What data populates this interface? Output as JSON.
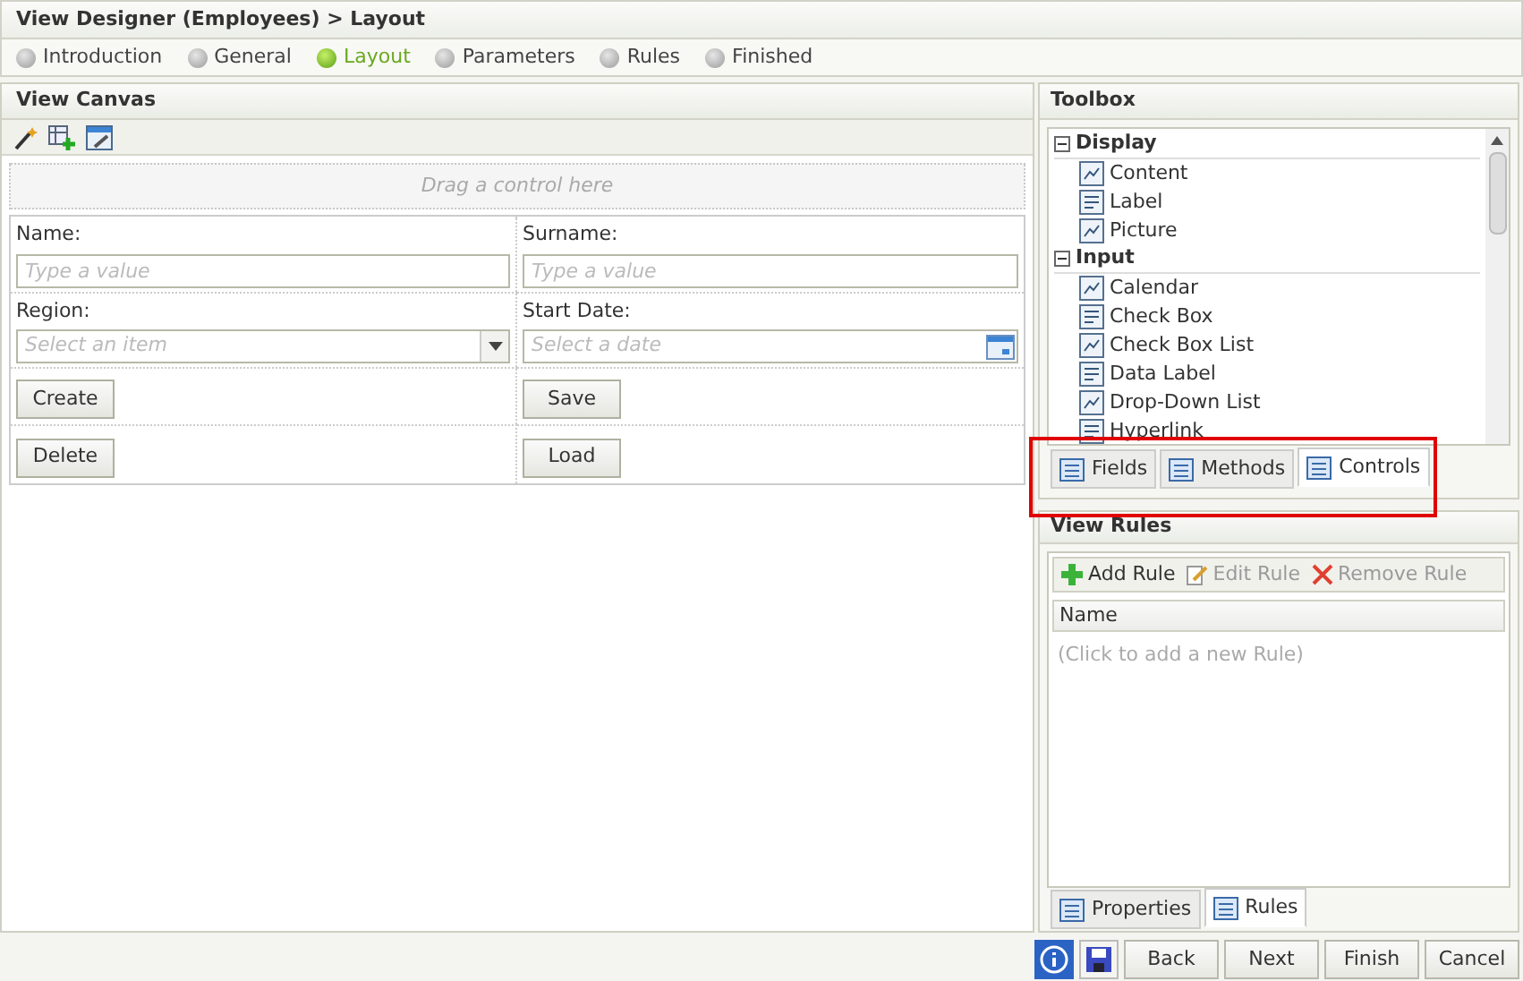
{
  "window": {
    "title": "View Designer (Employees) > Layout"
  },
  "steps": [
    {
      "label": "Introduction",
      "selected": false
    },
    {
      "label": "General",
      "selected": false
    },
    {
      "label": "Layout",
      "selected": true
    },
    {
      "label": "Parameters",
      "selected": false
    },
    {
      "label": "Rules",
      "selected": false
    },
    {
      "label": "Finished",
      "selected": false
    }
  ],
  "canvas": {
    "title": "View Canvas",
    "drop_hint": "Drag a control here",
    "rows": [
      [
        {
          "kind": "field",
          "label": "Name:",
          "placeholder": "Type a value"
        },
        {
          "kind": "field",
          "label": "Surname:",
          "placeholder": "Type a value"
        }
      ],
      [
        {
          "kind": "dropdown",
          "label": "Region:",
          "placeholder": "Select an item"
        },
        {
          "kind": "date",
          "label": "Start Date:",
          "placeholder": "Select a date"
        }
      ],
      [
        {
          "kind": "button",
          "label": "Create"
        },
        {
          "kind": "button",
          "label": "Save"
        }
      ],
      [
        {
          "kind": "button",
          "label": "Delete"
        },
        {
          "kind": "button",
          "label": "Load"
        }
      ]
    ]
  },
  "toolbox": {
    "title": "Toolbox",
    "groups": [
      {
        "label": "Display",
        "expanded": true,
        "items": [
          "Content",
          "Label",
          "Picture"
        ]
      },
      {
        "label": "Input",
        "expanded": true,
        "items": [
          "Calendar",
          "Check Box",
          "Check Box List",
          "Data Label",
          "Drop-Down List",
          "Hyperlink"
        ]
      }
    ],
    "tabs": [
      {
        "label": "Fields",
        "selected": false
      },
      {
        "label": "Methods",
        "selected": false
      },
      {
        "label": "Controls",
        "selected": true
      }
    ]
  },
  "rules": {
    "title": "View Rules",
    "actions": [
      {
        "label": "Add Rule",
        "disabled": false
      },
      {
        "label": "Edit Rule",
        "disabled": true
      },
      {
        "label": "Remove Rule",
        "disabled": true
      }
    ],
    "column": "Name",
    "empty_text": "(Click to add a new Rule)",
    "tabs": [
      {
        "label": "Properties",
        "selected": false
      },
      {
        "label": "Rules",
        "selected": true
      }
    ]
  },
  "buttons": [
    "Back",
    "Next",
    "Finish",
    "Cancel"
  ]
}
